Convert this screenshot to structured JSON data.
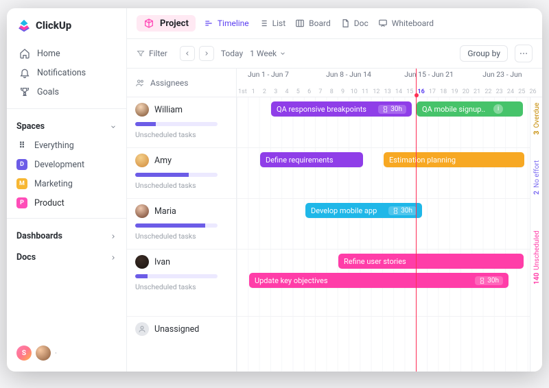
{
  "brand": "ClickUp",
  "nav": {
    "home": "Home",
    "notifications": "Notifications",
    "goals": "Goals"
  },
  "spaces_label": "Spaces",
  "spaces": [
    {
      "label": "Everything",
      "badge": "",
      "color": ""
    },
    {
      "label": "Development",
      "badge": "D",
      "color": "#6c5ce7"
    },
    {
      "label": "Marketing",
      "badge": "M",
      "color": "#f7b733"
    },
    {
      "label": "Product",
      "badge": "P",
      "color": "#ff4db8"
    }
  ],
  "dashboards_label": "Dashboards",
  "docs_label": "Docs",
  "presence_initial": "S",
  "header": {
    "project": "Project"
  },
  "views": {
    "timeline": "Timeline",
    "list": "List",
    "board": "Board",
    "doc": "Doc",
    "whiteboard": "Whiteboard"
  },
  "toolbar": {
    "filter": "Filter",
    "today": "Today",
    "range": "1 Week",
    "groupby": "Group by"
  },
  "timeline": {
    "group_header": "Assignees",
    "unscheduled_label": "Unscheduled tasks",
    "weeks": [
      "Jun 1 - Jun 7",
      "Jun 8 - Jun 14",
      "Jun 15 - Jun 21",
      "Jun 23 - Jun"
    ],
    "days_start": 1,
    "today_index": 16,
    "side": {
      "overdue_n": "3",
      "overdue_l": "Overdue",
      "effort_n": "2",
      "effort_l": "No effort",
      "unsch_n": "140",
      "unsch_l": "Unscheduled"
    },
    "people": [
      {
        "name": "William",
        "progress": 25
      },
      {
        "name": "Amy",
        "progress": 65
      },
      {
        "name": "Maria",
        "progress": 85
      },
      {
        "name": "Ivan",
        "progress": 15
      },
      {
        "name": "Unassigned",
        "progress": null
      }
    ],
    "tasks": [
      {
        "label": "QA responsive breakpoints",
        "hours": "30h",
        "color": "#8f3ee8"
      },
      {
        "label": "QA mobile signup..",
        "hours": null,
        "color": "#46c36a",
        "info": true
      },
      {
        "label": "Define requirements",
        "hours": null,
        "color": "#8f3ee8"
      },
      {
        "label": "Estimation planning",
        "hours": null,
        "color": "#f7a823"
      },
      {
        "label": "Develop mobile app",
        "hours": "30h",
        "color": "#1fb7e8"
      },
      {
        "label": "Refine user stories",
        "hours": null,
        "color": "#ff3da8"
      },
      {
        "label": "Update key objectives",
        "hours": "30h",
        "color": "#ff3da8"
      }
    ]
  }
}
